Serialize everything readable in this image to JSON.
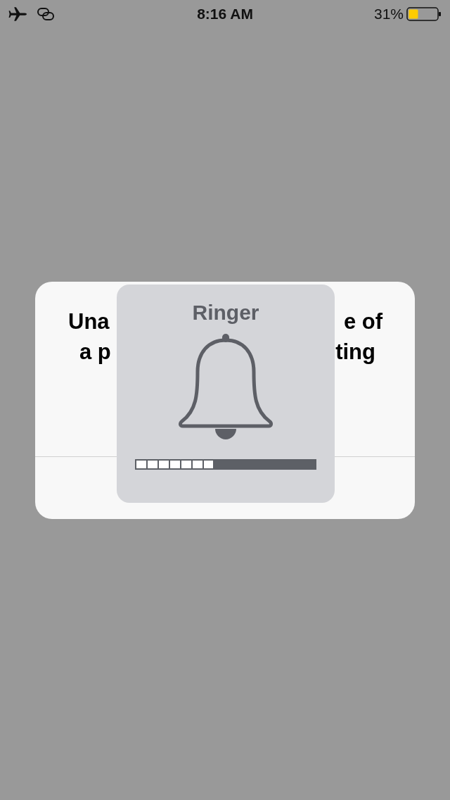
{
  "status_bar": {
    "time": "8:16 AM",
    "battery_percent": "31%"
  },
  "alert": {
    "lines": [
      {
        "left": "Una",
        "right": "e of"
      },
      {
        "left": "a p",
        "right": "ting"
      }
    ]
  },
  "ringer_hud": {
    "title": "Ringer",
    "level": 0.4375
  }
}
